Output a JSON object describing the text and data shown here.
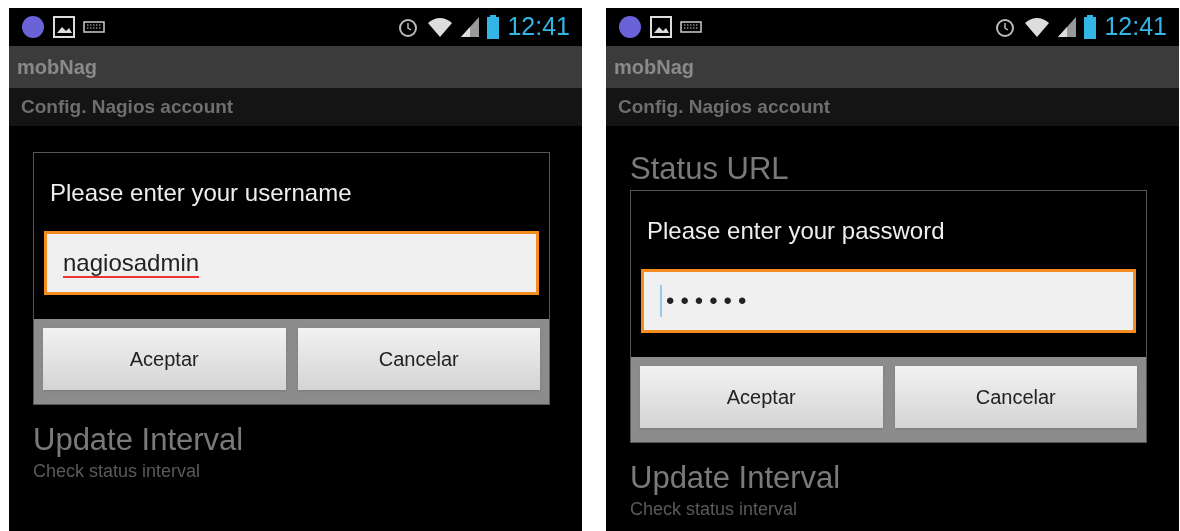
{
  "screens": [
    {
      "status_bar": {
        "time": "12:41"
      },
      "app_title": "mobNag",
      "subheader": "Config. Nagios account",
      "dialog": {
        "title": "Please enter your username",
        "field": {
          "kind": "text",
          "value": "nagiosadmin",
          "misspelled": true
        },
        "buttons": [
          "Aceptar",
          "Cancelar"
        ]
      },
      "items_below": [
        {
          "title": "Update Interval",
          "subtitle": "Check status interval"
        }
      ]
    },
    {
      "status_bar": {
        "time": "12:41"
      },
      "app_title": "mobNag",
      "subheader": "Config. Nagios account",
      "items_above": [
        {
          "title": "Status URL"
        }
      ],
      "dialog": {
        "title": "Please enter your password",
        "field": {
          "kind": "password",
          "value": "••••••",
          "misspelled": false
        },
        "buttons": [
          "Aceptar",
          "Cancelar"
        ]
      },
      "items_below": [
        {
          "title": "Update Interval",
          "subtitle": "Check status interval"
        }
      ]
    }
  ]
}
